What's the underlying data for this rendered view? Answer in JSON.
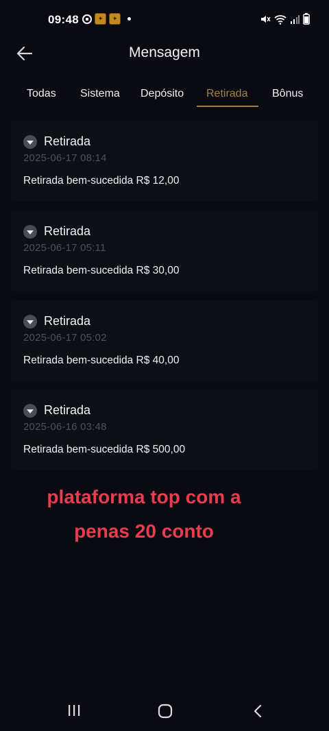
{
  "status_bar": {
    "time": "09:48",
    "left_icons": [
      "whatsapp-icon",
      "app-badge",
      "app-badge",
      "notification-dot"
    ],
    "right_icons": [
      "mute-icon",
      "wifi-icon",
      "signal-icon",
      "battery-icon"
    ]
  },
  "header": {
    "title": "Mensagem"
  },
  "tabs": [
    {
      "label": "Todas",
      "active": false
    },
    {
      "label": "Sistema",
      "active": false
    },
    {
      "label": "Depósito",
      "active": false
    },
    {
      "label": "Retirada",
      "active": true
    },
    {
      "label": "Bônus",
      "active": false
    }
  ],
  "messages": [
    {
      "title": "Retirada",
      "date": "2025-06-17 08:14",
      "text": "Retirada bem-sucedida R$ 12,00"
    },
    {
      "title": "Retirada",
      "date": "2025-06-17 05:11",
      "text": "Retirada bem-sucedida R$ 30,00"
    },
    {
      "title": "Retirada",
      "date": "2025-06-17 05:02",
      "text": "Retirada bem-sucedida R$ 40,00"
    },
    {
      "title": "Retirada",
      "date": "2025-06-16 03:48",
      "text": "Retirada bem-sucedida R$ 500,00"
    }
  ],
  "overlay": {
    "line1": "plataforma top com a",
    "line2": "penas 20 conto"
  },
  "colors": {
    "background": "#0a0b12",
    "card": "#0d0f17",
    "accent": "#a7813f",
    "overlay_text": "#e63d4f",
    "muted_text": "#4d505a"
  }
}
